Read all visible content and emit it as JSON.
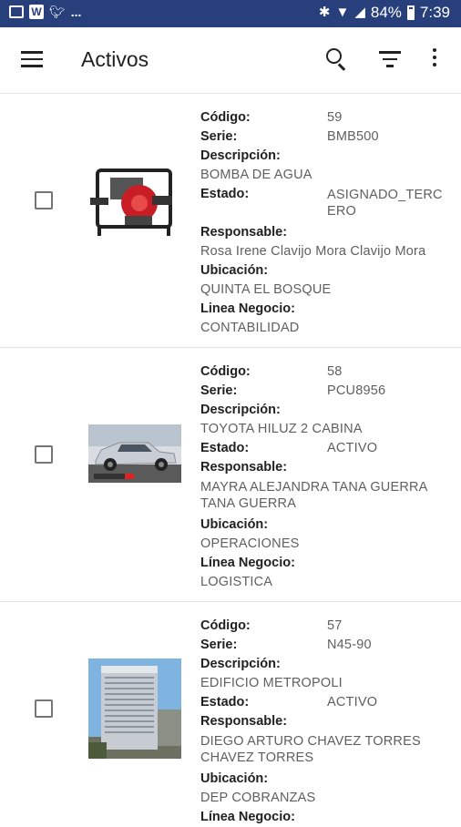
{
  "status_bar": {
    "battery": "84%",
    "time": "7:39",
    "overflow_indicator": "..."
  },
  "app_bar": {
    "title": "Activos",
    "icons": [
      "menu-icon",
      "search-icon",
      "filter-icon",
      "more-vert-icon"
    ]
  },
  "labels": {
    "code": "Código:",
    "serial": "Serie:",
    "description": "Descripción:",
    "status": "Estado:",
    "owner": "Responsable:",
    "location": "Ubicación:",
    "business_line": "Linea Negocio:",
    "business_line_accented": "Línea Negocio:"
  },
  "assets": [
    {
      "code": "59",
      "serial": "BMB500",
      "description": "BOMBA DE AGUA",
      "status": "ASIGNADO_TERCERO",
      "owner": "Rosa Irene Clavijo Mora Clavijo Mora",
      "location": "QUINTA EL BOSQUE",
      "business_line": "CONTABILIDAD",
      "image": "water-pump-image"
    },
    {
      "code": "58",
      "serial": "PCU8956",
      "description": "TOYOTA HILUZ 2 CABINA",
      "status": "ACTIVO",
      "owner": "MAYRA ALEJANDRA  TANA GUERRA TANA GUERRA",
      "location": "OPERACIONES",
      "business_line": "LOGISTICA",
      "image": "pickup-truck-image"
    },
    {
      "code": "57",
      "serial": "N45-90",
      "description": "EDIFICIO METROPOLI",
      "status": "ACTIVO",
      "owner": "DIEGO ARTURO CHAVEZ TORRES CHAVEZ TORRES",
      "location": "DEP COBRANZAS",
      "business_line": "",
      "image": "office-building-image"
    }
  ]
}
